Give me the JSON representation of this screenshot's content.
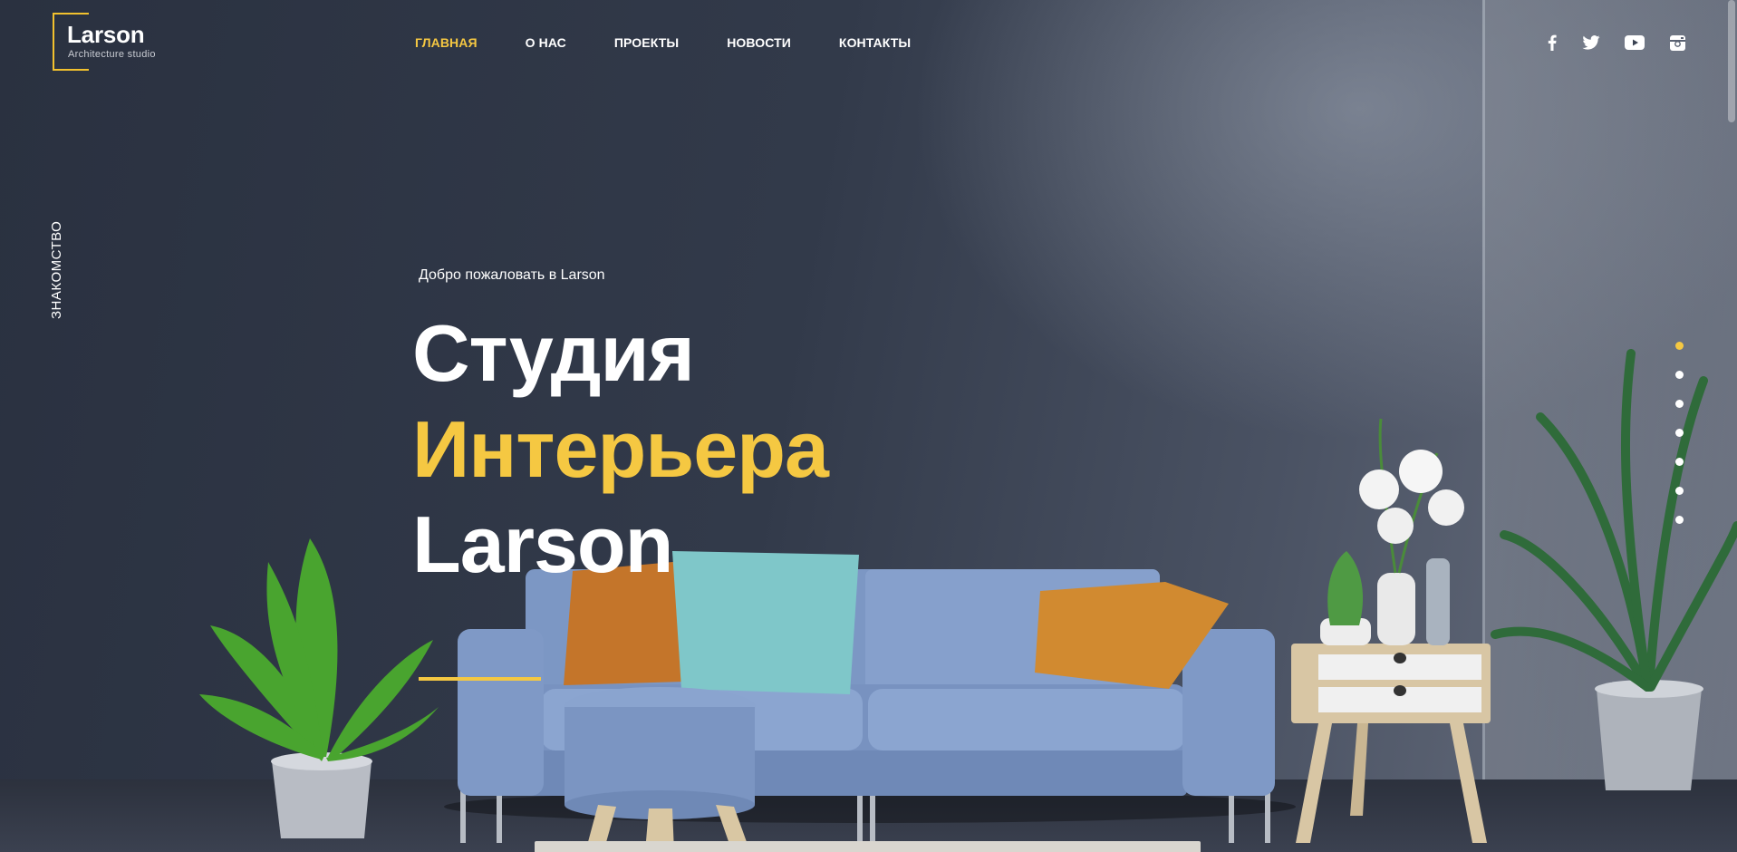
{
  "logo": {
    "name": "Larson",
    "subtitle": "Architecture studio"
  },
  "nav": {
    "items": [
      {
        "label": "ГЛАВНАЯ",
        "active": true
      },
      {
        "label": "О НАС",
        "active": false
      },
      {
        "label": "ПРОЕКТЫ",
        "active": false
      },
      {
        "label": "НОВОСТИ",
        "active": false
      },
      {
        "label": "КОНТАКТЫ",
        "active": false
      }
    ]
  },
  "social": [
    "facebook-icon",
    "twitter-icon",
    "youtube-icon",
    "instagram-icon"
  ],
  "side_label": "ЗНАКОМСТВО",
  "hero": {
    "welcome": "Добро пожаловать в Larson",
    "line1": "Студия",
    "line2": "Интерьера",
    "line3": "Larson"
  },
  "slider": {
    "total": 7,
    "active_index": 0
  },
  "colors": {
    "accent": "#f5c842",
    "text": "#ffffff",
    "background": "#2d3442"
  }
}
